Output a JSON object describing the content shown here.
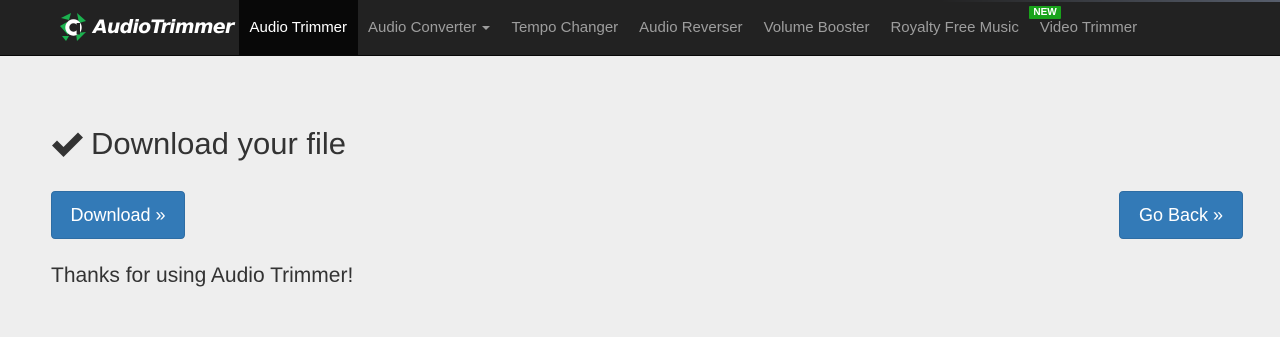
{
  "brand": {
    "logo_icon": "audio-trimmer-logo-icon",
    "name": "AudioTrimmer",
    "accent_color": "#1bb24f"
  },
  "nav": {
    "items": [
      {
        "label": "Audio Trimmer",
        "active": true
      },
      {
        "label": "Audio Converter",
        "active": false,
        "dropdown": true
      },
      {
        "label": "Tempo Changer",
        "active": false
      },
      {
        "label": "Audio Reverser",
        "active": false
      },
      {
        "label": "Volume Booster",
        "active": false
      },
      {
        "label": "Royalty Free Music",
        "active": false
      },
      {
        "label": "Video Trimmer",
        "active": false,
        "badge": "NEW"
      }
    ]
  },
  "main": {
    "heading_icon": "checkmark-icon",
    "heading": "Download your file",
    "download_button": "Download »",
    "back_button": "Go Back »",
    "thanks_message": "Thanks for using Audio Trimmer!"
  },
  "colors": {
    "navbar_bg": "#222222",
    "page_bg": "#eeeeee",
    "button_primary": "#337ab7",
    "badge_green": "#19a31b"
  }
}
